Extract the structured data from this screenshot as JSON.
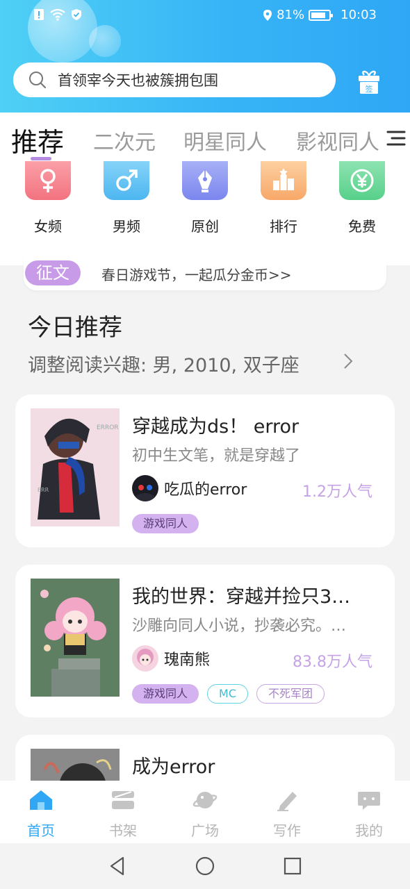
{
  "status_bar": {
    "battery": "81%",
    "battery_level": 0.81,
    "time": "10:03"
  },
  "search": {
    "placeholder": "首领宰今天也被簇拥包围"
  },
  "gift_icon_label": "签",
  "tabs": [
    {
      "label": "推荐",
      "active": true
    },
    {
      "label": "二次元",
      "active": false
    },
    {
      "label": "明星同人",
      "active": false
    },
    {
      "label": "影视同人",
      "active": false
    }
  ],
  "categories": [
    {
      "label": "女频",
      "icon": "female-icon",
      "color": "#f2737f"
    },
    {
      "label": "男频",
      "icon": "male-icon",
      "color": "#4cb6f0"
    },
    {
      "label": "原创",
      "icon": "pen-icon",
      "color": "#7b86ee"
    },
    {
      "label": "排行",
      "icon": "ranking-icon",
      "color": "#f8a869"
    },
    {
      "label": "免费",
      "icon": "yen-icon",
      "color": "#57d08a"
    }
  ],
  "banner": {
    "tag": "征文",
    "text": "春日游戏节，一起瓜分金币>>"
  },
  "section": {
    "title": "今日推荐",
    "subtitle": "调整阅读兴趣: 男, 2010, 双子座"
  },
  "books": [
    {
      "title": "穿越成为ds！ error",
      "desc": "初中生文笔，就是穿越了",
      "author": "吃瓜的error",
      "popularity": "1.2万人气",
      "tags": [
        {
          "label": "游戏同人",
          "style": "fill"
        }
      ]
    },
    {
      "title": "我的世界：穿越并捡只3…",
      "desc": "沙雕向同人小说，抄袭必究。…",
      "author": "瑰南熊",
      "popularity": "83.8万人气",
      "tags": [
        {
          "label": "游戏同人",
          "style": "fill"
        },
        {
          "label": "MC",
          "style": "cyan"
        },
        {
          "label": "不死军团",
          "style": "purple"
        }
      ]
    },
    {
      "title": "成为error",
      "desc": "",
      "author": "",
      "popularity": "",
      "tags": []
    }
  ],
  "bottom_nav": [
    {
      "label": "首页",
      "icon": "home-icon",
      "active": true
    },
    {
      "label": "书架",
      "icon": "bookshelf-icon",
      "active": false
    },
    {
      "label": "广场",
      "icon": "planet-icon",
      "active": false
    },
    {
      "label": "写作",
      "icon": "pencil-icon",
      "active": false
    },
    {
      "label": "我的",
      "icon": "chat-bubble-icon",
      "active": false
    }
  ],
  "colors": {
    "header": "#37b4f6",
    "accent_purple": "#c79be8",
    "nav_active": "#2fa7f5"
  }
}
